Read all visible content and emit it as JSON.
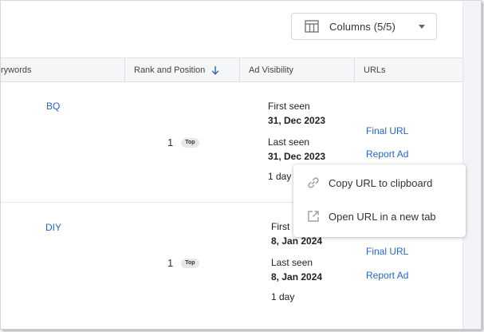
{
  "toolbar": {
    "columns_label": "Columns (5/5)"
  },
  "table": {
    "headers": {
      "keywords": "rywords",
      "rank": "Rank and Position",
      "visibility": "Ad Visibility",
      "urls": "URLs"
    },
    "rows": [
      {
        "keyword": "BQ",
        "rank": "1",
        "badge": "Top",
        "first_seen_label": "First seen",
        "first_seen": "31, Dec 2023",
        "last_seen_label": "Last seen",
        "last_seen": "31, Dec 2023",
        "duration": "1 day",
        "final_url": "Final URL",
        "report_ad": "Report Ad"
      },
      {
        "keyword": "DIY",
        "rank": "1",
        "badge": "Top",
        "first_seen_label": "First",
        "first_seen": "8, Jan 2024",
        "last_seen_label": "Last seen",
        "last_seen": "8, Jan 2024",
        "duration": "1 day",
        "final_url": "Final URL",
        "report_ad": "Report Ad"
      }
    ]
  },
  "context_menu": {
    "items": [
      {
        "label": "Copy URL to clipboard",
        "icon": "link-icon"
      },
      {
        "label": "Open URL in a new tab",
        "icon": "open-in-new-icon"
      }
    ]
  },
  "colors": {
    "link": "#2a63c8",
    "header_bg": "#f5f6f8"
  }
}
